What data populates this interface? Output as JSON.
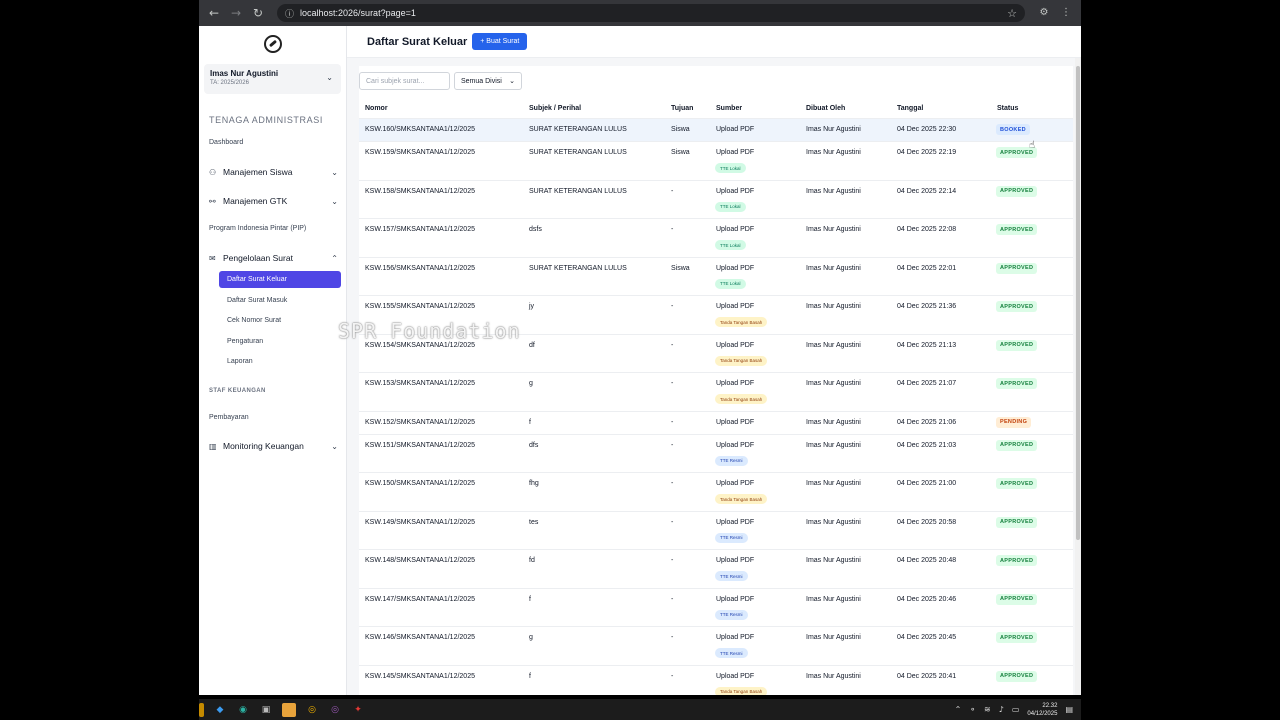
{
  "browser": {
    "url": "localhost:2026/surat?page=1"
  },
  "sidebar": {
    "user_name": "Imas Nur Agustini",
    "user_ta": "TA: 2025/2026",
    "section_admin": "TENAGA ADMINISTRASI",
    "dashboard": "Dashboard",
    "manajemen_siswa": "Manajemen Siswa",
    "manajemen_gtk": "Manajemen GTK",
    "pip": "Program Indonesia Pintar (PIP)",
    "pengelolaan_surat": "Pengelolaan Surat",
    "sub_items": [
      "Daftar Surat Keluar",
      "Daftar Surat Masuk",
      "Cek Nomor Surat",
      "Pengaturan",
      "Laporan"
    ],
    "section_keuangan": "STAF KEUANGAN",
    "pembayaran": "Pembayaran",
    "monitoring_keuangan": "Monitoring Keuangan"
  },
  "header": {
    "title": "Daftar Surat Keluar",
    "create_button": "+ Buat Surat"
  },
  "filters": {
    "search_placeholder": "Cari subjek surat...",
    "divisi": "Semua Divisi"
  },
  "table": {
    "columns": [
      "Nomor",
      "Subjek / Perihal",
      "Tujuan",
      "Sumber",
      "Dibuat Oleh",
      "Tanggal",
      "Status"
    ],
    "rows": [
      {
        "nomor": "KSW.160/SMKSANTANA1/12/2025",
        "subjek": "SURAT KETERANGAN LULUS",
        "tujuan": "Siswa",
        "sumber": "Upload PDF",
        "tag": "",
        "oleh": "Imas Nur Agustini",
        "tanggal": "04 Dec 2025 22:30",
        "status": "BOOKED"
      },
      {
        "nomor": "KSW.159/SMKSANTANA1/12/2025",
        "subjek": "SURAT KETERANGAN LULUS",
        "tujuan": "Siswa",
        "sumber": "Upload PDF",
        "tag": "TTE Lokal",
        "oleh": "Imas Nur Agustini",
        "tanggal": "04 Dec 2025 22:19",
        "status": "APPROVED"
      },
      {
        "nomor": "KSW.158/SMKSANTANA1/12/2025",
        "subjek": "SURAT KETERANGAN LULUS",
        "tujuan": "-",
        "sumber": "Upload PDF",
        "tag": "TTE Lokal",
        "oleh": "Imas Nur Agustini",
        "tanggal": "04 Dec 2025 22:14",
        "status": "APPROVED"
      },
      {
        "nomor": "KSW.157/SMKSANTANA1/12/2025",
        "subjek": "dsfs",
        "tujuan": "-",
        "sumber": "Upload PDF",
        "tag": "TTE Lokal",
        "oleh": "Imas Nur Agustini",
        "tanggal": "04 Dec 2025 22:08",
        "status": "APPROVED"
      },
      {
        "nomor": "KSW.156/SMKSANTANA1/12/2025",
        "subjek": "SURAT KETERANGAN LULUS",
        "tujuan": "Siswa",
        "sumber": "Upload PDF",
        "tag": "TTE Lokal",
        "oleh": "Imas Nur Agustini",
        "tanggal": "04 Dec 2025 22:01",
        "status": "APPROVED"
      },
      {
        "nomor": "KSW.155/SMKSANTANA1/12/2025",
        "subjek": "jy",
        "tujuan": "-",
        "sumber": "Upload PDF",
        "tag": "Tanda Tangan Basah",
        "oleh": "Imas Nur Agustini",
        "tanggal": "04 Dec 2025 21:36",
        "status": "APPROVED"
      },
      {
        "nomor": "KSW.154/SMKSANTANA1/12/2025",
        "subjek": "df",
        "tujuan": "-",
        "sumber": "Upload PDF",
        "tag": "Tanda Tangan Basah",
        "oleh": "Imas Nur Agustini",
        "tanggal": "04 Dec 2025 21:13",
        "status": "APPROVED"
      },
      {
        "nomor": "KSW.153/SMKSANTANA1/12/2025",
        "subjek": "g",
        "tujuan": "-",
        "sumber": "Upload PDF",
        "tag": "Tanda Tangan Basah",
        "oleh": "Imas Nur Agustini",
        "tanggal": "04 Dec 2025 21:07",
        "status": "APPROVED"
      },
      {
        "nomor": "KSW.152/SMKSANTANA1/12/2025",
        "subjek": "f",
        "tujuan": "-",
        "sumber": "Upload PDF",
        "tag": "",
        "oleh": "Imas Nur Agustini",
        "tanggal": "04 Dec 2025 21:06",
        "status": "PENDING"
      },
      {
        "nomor": "KSW.151/SMKSANTANA1/12/2025",
        "subjek": "dfs",
        "tujuan": "-",
        "sumber": "Upload PDF",
        "tag": "TTE Resmi",
        "oleh": "Imas Nur Agustini",
        "tanggal": "04 Dec 2025 21:03",
        "status": "APPROVED"
      },
      {
        "nomor": "KSW.150/SMKSANTANA1/12/2025",
        "subjek": "fhg",
        "tujuan": "-",
        "sumber": "Upload PDF",
        "tag": "Tanda Tangan Basah",
        "oleh": "Imas Nur Agustini",
        "tanggal": "04 Dec 2025 21:00",
        "status": "APPROVED"
      },
      {
        "nomor": "KSW.149/SMKSANTANA1/12/2025",
        "subjek": "tes",
        "tujuan": "-",
        "sumber": "Upload PDF",
        "tag": "TTE Resmi",
        "oleh": "Imas Nur Agustini",
        "tanggal": "04 Dec 2025 20:58",
        "status": "APPROVED"
      },
      {
        "nomor": "KSW.148/SMKSANTANA1/12/2025",
        "subjek": "fd",
        "tujuan": "-",
        "sumber": "Upload PDF",
        "tag": "TTE Resmi",
        "oleh": "Imas Nur Agustini",
        "tanggal": "04 Dec 2025 20:48",
        "status": "APPROVED"
      },
      {
        "nomor": "KSW.147/SMKSANTANA1/12/2025",
        "subjek": "f",
        "tujuan": "-",
        "sumber": "Upload PDF",
        "tag": "TTE Resmi",
        "oleh": "Imas Nur Agustini",
        "tanggal": "04 Dec 2025 20:46",
        "status": "APPROVED"
      },
      {
        "nomor": "KSW.146/SMKSANTANA1/12/2025",
        "subjek": "g",
        "tujuan": "-",
        "sumber": "Upload PDF",
        "tag": "TTE Resmi",
        "oleh": "Imas Nur Agustini",
        "tanggal": "04 Dec 2025 20:45",
        "status": "APPROVED"
      },
      {
        "nomor": "KSW.145/SMKSANTANA1/12/2025",
        "subjek": "f",
        "tujuan": "-",
        "sumber": "Upload PDF",
        "tag": "Tanda Tangan Basah",
        "oleh": "Imas Nur Agustini",
        "tanggal": "04 Dec 2025 20:41",
        "status": "APPROVED"
      }
    ]
  },
  "watermark": "SPR Foundation",
  "taskbar": {
    "time": "22.32",
    "date": "04/12/2025"
  },
  "colors": {
    "accent": "#4f46e5",
    "primary_button": "#2563eb",
    "approved": "#15803d",
    "booked": "#1d4ed8",
    "pending": "#c2410c"
  }
}
